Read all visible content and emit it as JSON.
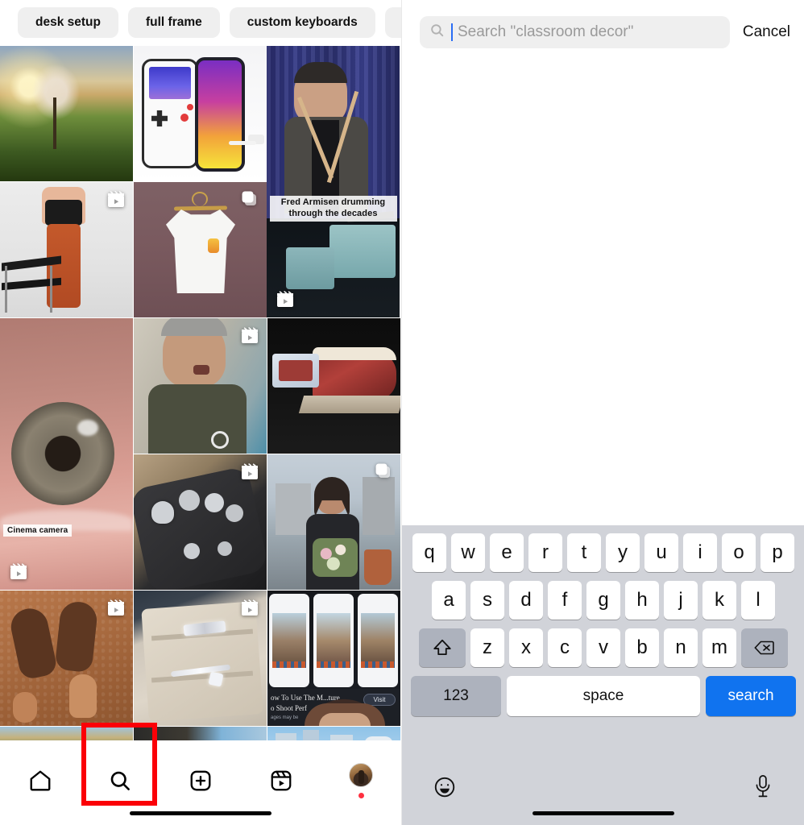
{
  "left": {
    "chips": [
      {
        "label": "desk setup"
      },
      {
        "label": "full frame"
      },
      {
        "label": "custom keyboards"
      },
      {
        "label": ""
      }
    ],
    "grid": {
      "tiles": [
        {
          "name": "sunrise-tree-field",
          "caption": "",
          "badge": "none"
        },
        {
          "name": "gameboy-phone-case",
          "caption": "",
          "badge": "none"
        },
        {
          "name": "fred-armisen-drumming",
          "caption": "Fred Armisen drumming through the decades",
          "badge": "reels"
        },
        {
          "name": "woman-orange-pants",
          "caption": "",
          "badge": "reels"
        },
        {
          "name": "white-tshirt-hanger",
          "caption": "",
          "badge": "carousel"
        },
        {
          "name": "closeup-eye",
          "caption": "Cinema camera",
          "badge": "reels"
        },
        {
          "name": "anthony-bourdain-interview",
          "caption": "",
          "badge": "reels"
        },
        {
          "name": "cured-meat-board",
          "caption": "",
          "badge": "none"
        },
        {
          "name": "skull-rings-hand",
          "caption": "",
          "badge": "reels"
        },
        {
          "name": "woman-with-flowers-rooftop",
          "caption": "",
          "badge": "carousel"
        },
        {
          "name": "sandals-on-sand",
          "caption": "",
          "badge": "reels"
        },
        {
          "name": "diamond-rings-box",
          "caption": "",
          "badge": "reels"
        },
        {
          "name": "phone-screenshots-tutorial",
          "caption": "",
          "badge": "none",
          "ad_line1": "ow To Use The M...ture",
          "ad_line2": "o Shoot Perf",
          "ad_button": "Visit"
        },
        {
          "name": "partial-row-autumn",
          "caption": "",
          "badge": "none"
        },
        {
          "name": "partial-row-dark",
          "caption": "",
          "badge": "none"
        },
        {
          "name": "partial-row-city",
          "caption": "",
          "badge": "none"
        }
      ]
    },
    "tabbar": {
      "items": [
        {
          "name": "home",
          "icon": "home-icon"
        },
        {
          "name": "search",
          "icon": "search-icon"
        },
        {
          "name": "create",
          "icon": "plus-square-icon"
        },
        {
          "name": "reels",
          "icon": "reels-icon"
        },
        {
          "name": "profile",
          "icon": "avatar"
        }
      ],
      "highlight_color": "#fb0007",
      "notification_dot_color": "#ff3040"
    }
  },
  "right": {
    "search": {
      "placeholder": "Search \"classroom decor\"",
      "value": "",
      "cancel_label": "Cancel"
    },
    "keyboard": {
      "row1": [
        "q",
        "w",
        "e",
        "r",
        "t",
        "y",
        "u",
        "i",
        "o",
        "p"
      ],
      "row2": [
        "a",
        "s",
        "d",
        "f",
        "g",
        "h",
        "j",
        "k",
        "l"
      ],
      "row3": [
        "z",
        "x",
        "c",
        "v",
        "b",
        "n",
        "m"
      ],
      "shift_label": "shift",
      "backspace_label": "delete",
      "numbers_label": "123",
      "space_label": "space",
      "return_label": "search",
      "return_color": "#1073ef",
      "emoji_label": "emoji",
      "dictation_label": "dictation"
    }
  }
}
